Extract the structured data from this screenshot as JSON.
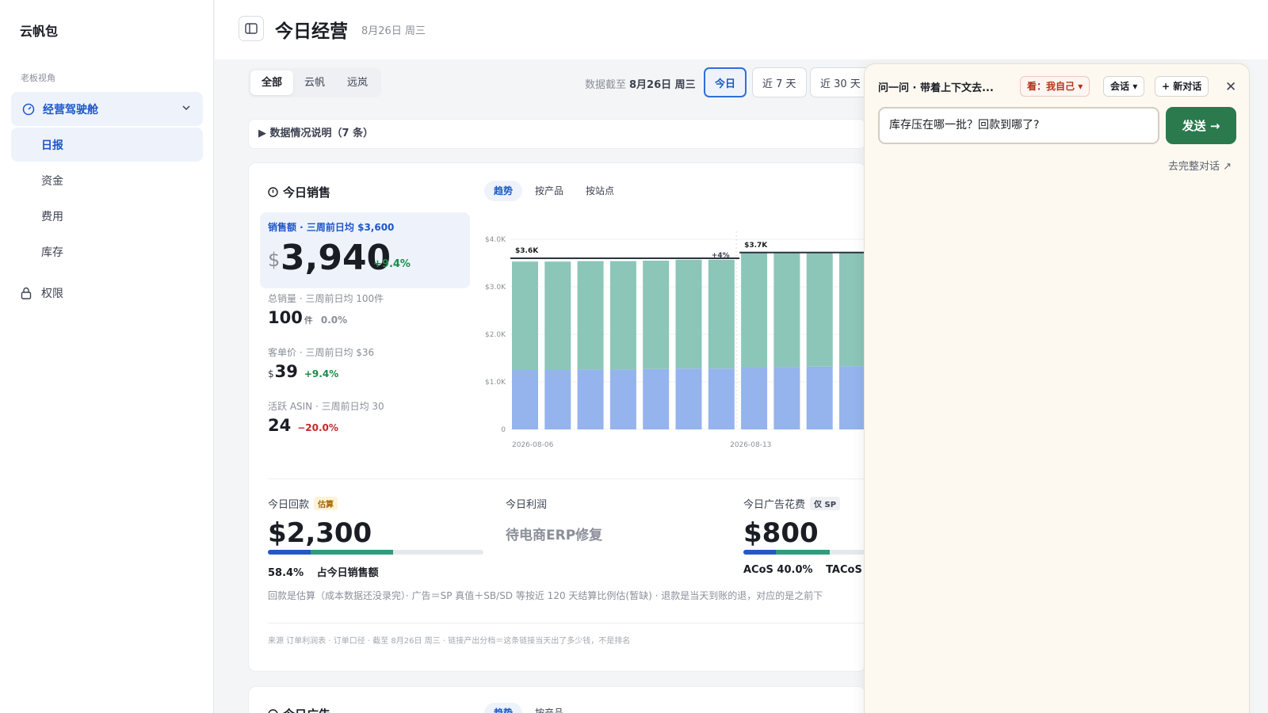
{
  "app": {
    "brand": "云帆包"
  },
  "sidebar": {
    "section": "老板视角",
    "group": "经营驾驶舱",
    "items": [
      {
        "label": "日报",
        "active": true
      },
      {
        "label": "资金",
        "active": false
      },
      {
        "label": "费用",
        "active": false
      },
      {
        "label": "库存",
        "active": false
      }
    ],
    "permissions": "权限"
  },
  "header": {
    "title": "今日经营",
    "date": "8月26日 周三"
  },
  "filters": {
    "scope": [
      "全部",
      "云帆",
      "远岚"
    ],
    "asof_label": "数据截至",
    "asof_value": "8月26日 周三",
    "ranges": [
      "今日",
      "近 7 天",
      "近 30 天"
    ]
  },
  "notes": "▶ 数据情况说明（7 条）",
  "sales": {
    "title": "今日销售",
    "tabs": [
      "趋势",
      "按产品",
      "按站点"
    ],
    "hero": {
      "label": "销售额 · 三周前日均 $3,600",
      "currency": "$",
      "value": "3,940",
      "delta": "+9.4%"
    },
    "units": {
      "label": "总销量 · 三周前日均 100件",
      "value": "100",
      "unit": "件",
      "delta": "0.0%"
    },
    "aov": {
      "label": "客单价 · 三周前日均 $36",
      "currency": "$",
      "value": "39",
      "delta": "+9.4%"
    },
    "asin": {
      "label": "活跃 ASIN · 三周前日均 30",
      "value": "24",
      "delta": "−20.0%"
    }
  },
  "chart_data": {
    "type": "bar",
    "stacked": true,
    "categories": [
      "2026-08-06",
      "",
      "",
      "",
      "",
      "",
      "",
      "2026-08-13",
      "",
      "",
      ""
    ],
    "x_tick_labels": [
      "2026-08-06",
      "2026-08-13"
    ],
    "series": [
      {
        "values": [
          1250,
          1250,
          1260,
          1260,
          1270,
          1280,
          1280,
          1300,
          1310,
          1320,
          1330
        ],
        "color": "#95b3ed"
      },
      {
        "values": [
          2280,
          2280,
          2280,
          2280,
          2280,
          2290,
          2290,
          2410,
          2400,
          2410,
          2400
        ],
        "color": "#8bc6b9"
      }
    ],
    "ylim": [
      0,
      4000
    ],
    "yticks": [
      "0",
      "$1.0K",
      "$2.0K",
      "$3.0K",
      "$4.0K"
    ],
    "reference_lines": [
      {
        "label": "$3.6K",
        "value": 3600,
        "from": 0,
        "to": 6
      },
      {
        "label": "$3.7K",
        "value": 3720,
        "from": 7,
        "to": 10
      }
    ],
    "annotations": [
      "+4%"
    ]
  },
  "kpis": {
    "payback": {
      "label": "今日回款",
      "badge": "估算",
      "value": "$2,300",
      "pct": "58.4%",
      "pct_label": "占今日销售额",
      "fill_a": 0.2,
      "fill_b": 0.58
    },
    "profit": {
      "label": "今日利润",
      "value": "待电商ERP修复"
    },
    "ads": {
      "label": "今日广告花费",
      "badge": "仅 SP",
      "value": "$800",
      "acos": "ACoS 40.0%",
      "tacos": "TACoS",
      "fill_a": 0.15,
      "fill_b": 0.4
    }
  },
  "footnote": "回款是估算（成本数据还没录完）· 广告＝SP 真值＋SB/SD 等按近 120 天结算比例估(暂缺) · 退款是当天到账的退，对应的是之前下",
  "source": "来源 订单利润表 · 订单口径 · 截至 8月26日 周三 · 链接产出分档＝这条链接当天出了多少钱，不是排名",
  "ads_card": {
    "title": "今日广告",
    "tabs": [
      "趋势",
      "按产品"
    ]
  },
  "chat": {
    "title": "问一问 · 带着上下文去...",
    "who": "看：我自己",
    "session": "会话",
    "new_chat": "+ 新对话",
    "input": "库存压在哪一批？回款到哪了?",
    "send": "发送 →",
    "full_link": "去完整对话 ↗"
  }
}
